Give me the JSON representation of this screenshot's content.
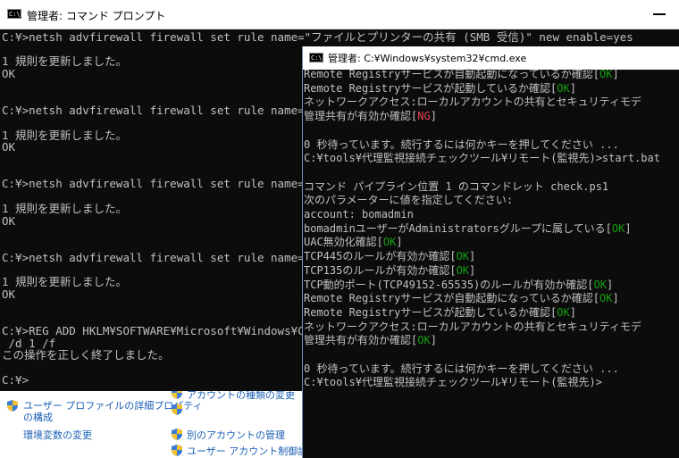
{
  "control_panel": {
    "items": [
      {
        "label": "アカウントの種類の変更"
      },
      {
        "label": "ユーザー プロファイルの詳細プロパティ"
      },
      {
        "label": "の構成"
      },
      {
        "label": "環境変数の変更"
      },
      {
        "label": "別のアカウントの管理"
      },
      {
        "label": "ユーザー アカウント制御設定の変"
      }
    ]
  },
  "window1": {
    "icon": "C:\\",
    "title": "管理者: コマンド プロンプト",
    "lines": [
      "C:¥>netsh advfirewall firewall set rule name=\"ファイルとプリンターの共有 (SMB 受信)\" new enable=yes",
      "",
      "1 規則を更新しました。",
      "OK",
      "",
      "",
      "C:¥>netsh advfirewall firewall set rule name=\"COM+",
      "",
      "1 規則を更新しました。",
      "OK",
      "",
      "",
      "C:¥>netsh advfirewall firewall set rule name=\"リモ",
      "",
      "1 規則を更新しました。",
      "OK",
      "",
      "",
      "C:¥>netsh advfirewall firewall set rule name=\"リモ",
      "",
      "1 規則を更新しました。",
      "OK",
      "",
      "",
      "C:¥>REG ADD HKLM¥SOFTWARE¥Microsoft¥Windows¥Curren",
      " /d 1 /f",
      "この操作を正しく終了しました。",
      "",
      "C:¥>"
    ]
  },
  "window2": {
    "icon": "C:\\",
    "title": "管理者: C:¥Windows¥system32¥cmd.exe",
    "lines": [
      {
        "text": "Remote Registryサービスが自動起動になっているか確認[",
        "status": "OK",
        "tail": "]"
      },
      {
        "text": "Remote Registryサービスが起動しているか確認[",
        "status": "OK",
        "tail": "]"
      },
      {
        "text": "ネットワークアクセス:ローカルアカウントの共有とセキュリティモデ",
        "status": "",
        "tail": ""
      },
      {
        "text": "管理共有が有効か確認[",
        "status": "NG",
        "tail": "]"
      },
      {
        "text": "",
        "status": "",
        "tail": ""
      },
      {
        "text": "0 秒待っています。続行するには何かキーを押してください ...",
        "status": "",
        "tail": ""
      },
      {
        "text": "C:¥tools¥代理監視接続チェックツール¥リモート(監視先)>start.bat",
        "status": "",
        "tail": ""
      },
      {
        "text": "",
        "status": "",
        "tail": ""
      },
      {
        "text": "コマンド パイプライン位置 1 のコマンドレット check.ps1",
        "status": "",
        "tail": ""
      },
      {
        "text": "次のパラメーターに値を指定してください:",
        "status": "",
        "tail": ""
      },
      {
        "text": "account: bomadmin",
        "status": "",
        "tail": ""
      },
      {
        "text": "bomadminユーザーがAdministratorsグループに属している[",
        "status": "OK",
        "tail": "]"
      },
      {
        "text": "UAC無効化確認[",
        "status": "OK",
        "tail": "]"
      },
      {
        "text": "TCP445のルールが有効か確認[",
        "status": "OK",
        "tail": "]"
      },
      {
        "text": "TCP135のルールが有効か確認[",
        "status": "OK",
        "tail": "]"
      },
      {
        "text": "TCP動的ポート(TCP49152-65535)のルールが有効か確認[",
        "status": "OK",
        "tail": "]"
      },
      {
        "text": "Remote Registryサービスが自動起動になっているか確認[",
        "status": "OK",
        "tail": "]"
      },
      {
        "text": "Remote Registryサービスが起動しているか確認[",
        "status": "OK",
        "tail": "]"
      },
      {
        "text": "ネットワークアクセス:ローカルアカウントの共有とセキュリティモデ",
        "status": "",
        "tail": ""
      },
      {
        "text": "管理共有が有効か確認[",
        "status": "OK",
        "tail": "]"
      },
      {
        "text": "",
        "status": "",
        "tail": ""
      },
      {
        "text": "0 秒待っています。続行するには何かキーを押してください ...",
        "status": "",
        "tail": ""
      },
      {
        "text": "C:¥tools¥代理監視接続チェックツール¥リモート(監視先)>",
        "status": "",
        "tail": ""
      }
    ]
  },
  "colors": {
    "ok": "#13a10e",
    "ng": "#e74856",
    "console_bg": "#0c0c0c",
    "console_fg": "#c0c0c0"
  }
}
